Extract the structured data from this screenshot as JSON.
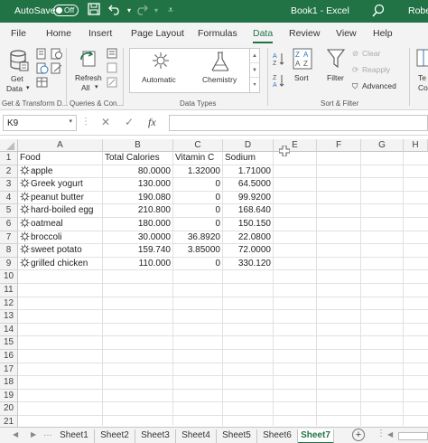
{
  "titlebar": {
    "autosave_label": "AutoSave",
    "autosave_state": "Off",
    "doc_title": "Book1  -  Excel",
    "user": "Rober"
  },
  "ribbon_tabs": [
    "File",
    "Home",
    "Insert",
    "Page Layout",
    "Formulas",
    "Data",
    "Review",
    "View",
    "Help"
  ],
  "active_tab": "Data",
  "ribbon": {
    "get_data_label": "Get",
    "get_data_label2": "Data",
    "refresh_label": "Refresh",
    "refresh_label2": "All",
    "group_get_transform": "Get & Transform D...",
    "group_queries": "Queries & Con...",
    "data_type_automatic": "Automatic",
    "data_type_chemistry": "Chemistry",
    "group_data_types": "Data Types",
    "sort_label": "Sort",
    "filter_label": "Filter",
    "clear_label": "Clear",
    "reapply_label": "Reapply",
    "advanced_label": "Advanced",
    "group_sort_filter": "Sort & Filter",
    "text_to_cols": "Te",
    "text_to_cols2": "Co"
  },
  "formula_bar": {
    "name_box": "K9",
    "fx": "fx",
    "value": ""
  },
  "columns": [
    "A",
    "B",
    "C",
    "D",
    "E",
    "F",
    "G",
    "H"
  ],
  "rows": [
    "1",
    "2",
    "3",
    "4",
    "5",
    "6",
    "7",
    "8",
    "9",
    "10",
    "11",
    "12",
    "13",
    "14",
    "15",
    "16",
    "17",
    "18",
    "19",
    "20",
    "21"
  ],
  "table": {
    "headers": [
      "Food",
      "Total Calories",
      "Vitamin C",
      "Sodium"
    ],
    "rows": [
      [
        "apple",
        "80.0000",
        "1.32000",
        "1.71000"
      ],
      [
        "Greek yogurt",
        "130.000",
        "0",
        "64.5000"
      ],
      [
        "peanut butter",
        "190.080",
        "0",
        "99.9200"
      ],
      [
        "hard-boiled egg",
        "210.800",
        "0",
        "168.640"
      ],
      [
        "oatmeal",
        "180.000",
        "0",
        "150.150"
      ],
      [
        "broccoli",
        "30.0000",
        "36.8920",
        "22.0800"
      ],
      [
        "sweet potato",
        "159.740",
        "3.85000",
        "72.0000"
      ],
      [
        "grilled chicken",
        "110.000",
        "0",
        "330.120"
      ]
    ]
  },
  "sheets": [
    "Sheet1",
    "Sheet2",
    "Sheet3",
    "Sheet4",
    "Sheet5",
    "Sheet6",
    "Sheet7"
  ],
  "active_sheet": "Sheet7",
  "colors": {
    "accent": "#217346"
  }
}
